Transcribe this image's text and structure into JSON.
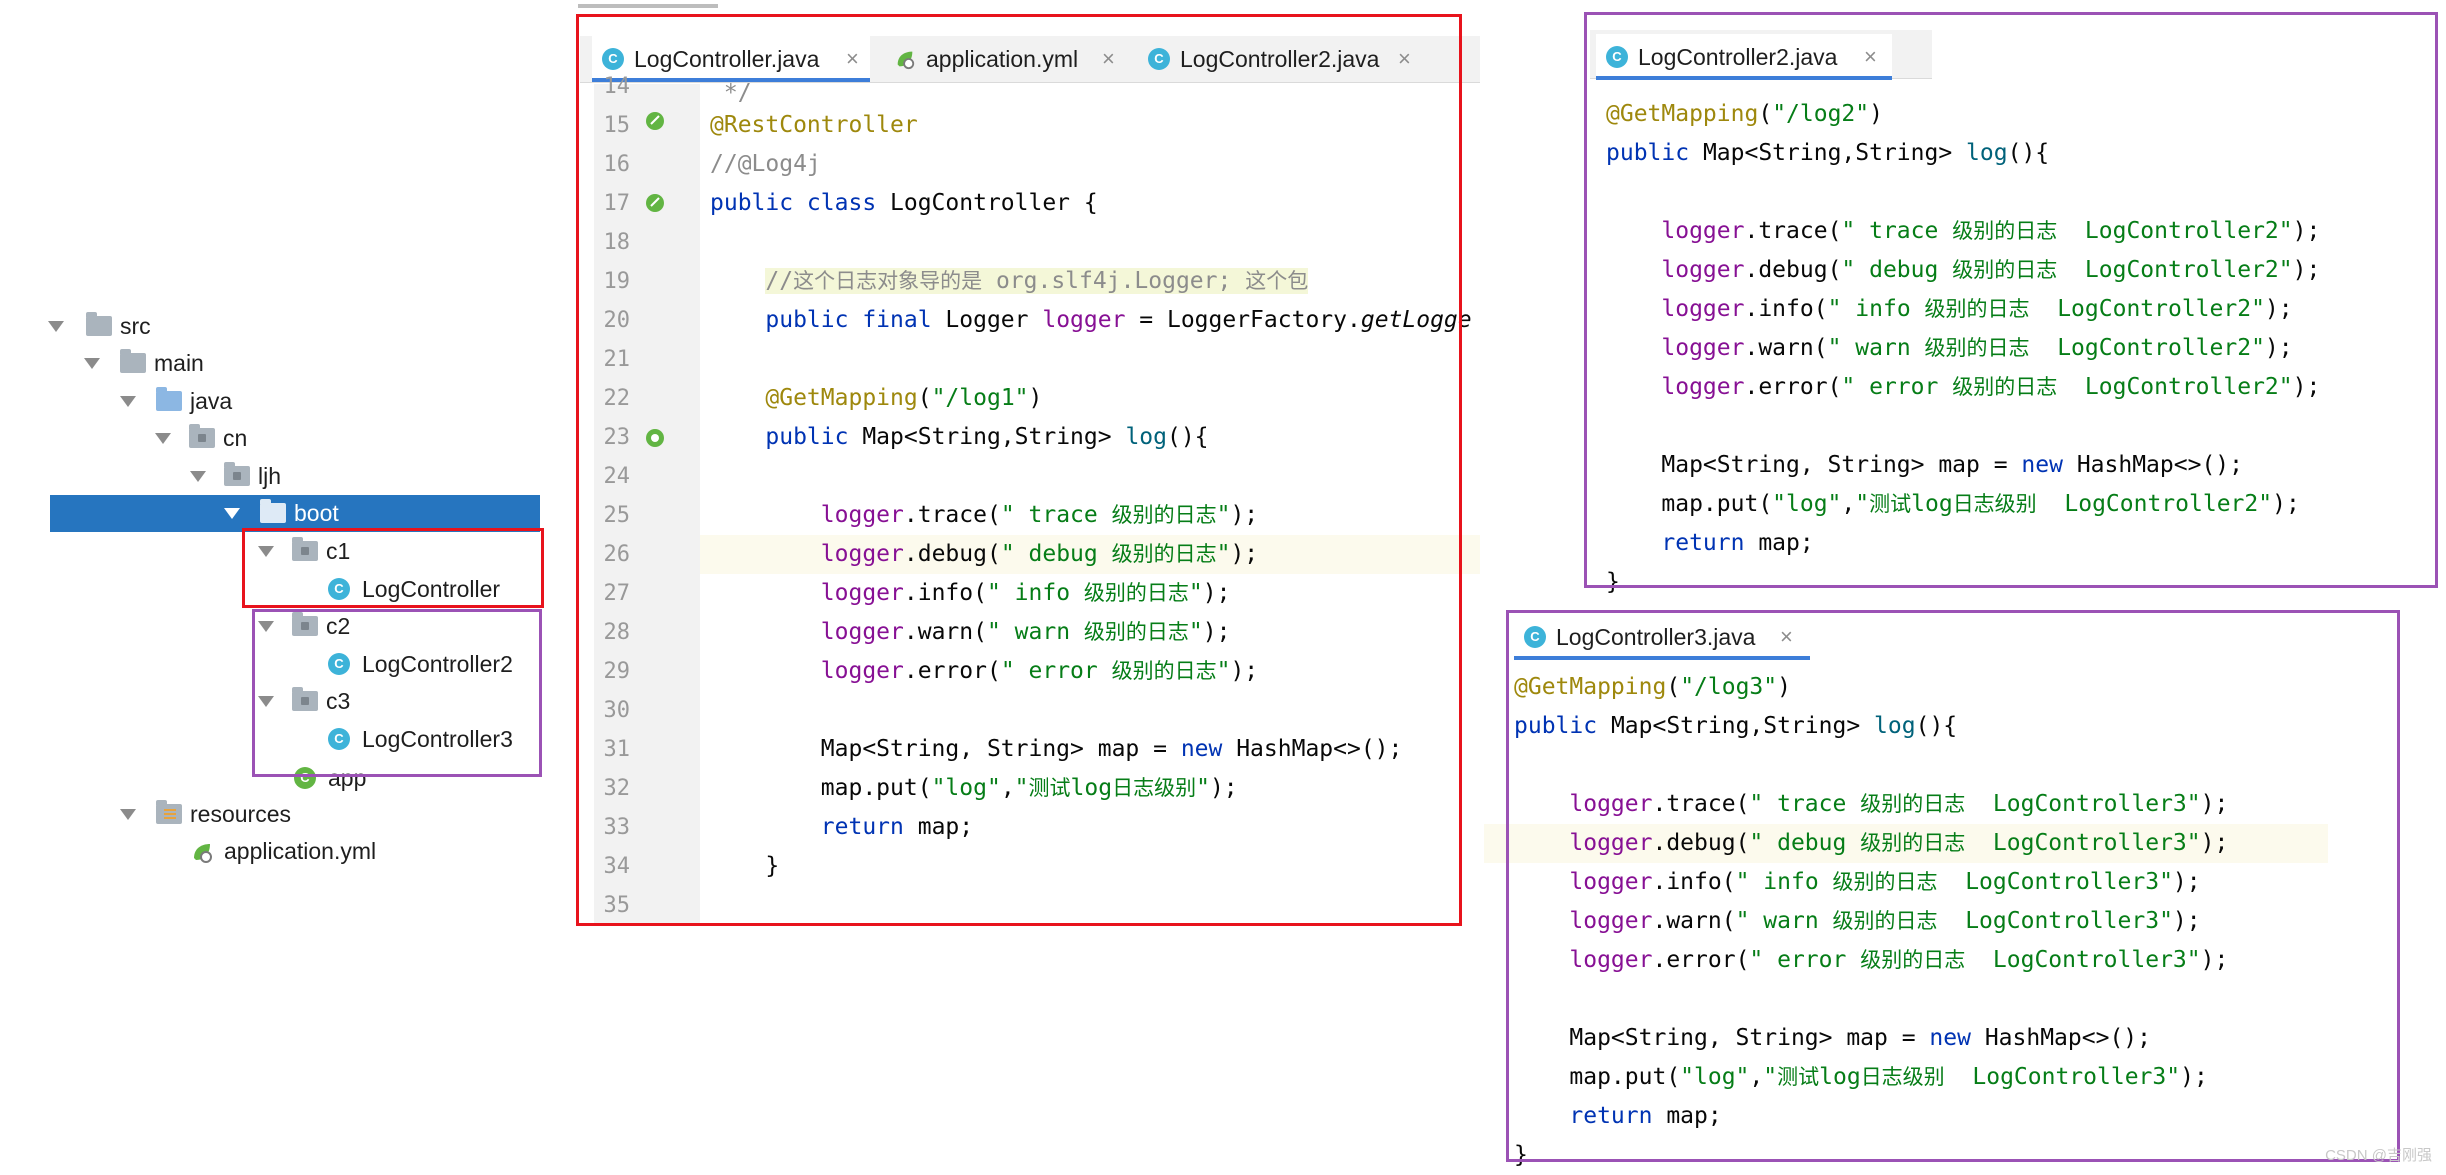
{
  "tree": {
    "items": [
      {
        "label": "src"
      },
      {
        "label": "main"
      },
      {
        "label": "java"
      },
      {
        "label": "cn"
      },
      {
        "label": "ljh"
      },
      {
        "label": "boot"
      },
      {
        "label": "c1"
      },
      {
        "label": "LogController"
      },
      {
        "label": "c2"
      },
      {
        "label": "LogController2"
      },
      {
        "label": "c3"
      },
      {
        "label": "LogController3"
      },
      {
        "label": "app"
      },
      {
        "label": "resources"
      },
      {
        "label": "application.yml"
      }
    ]
  },
  "editor1": {
    "tabs": [
      {
        "label": "LogController.java"
      },
      {
        "label": "application.yml"
      },
      {
        "label": "LogController2.java"
      }
    ],
    "line_numbers": [
      "14",
      "15",
      "16",
      "17",
      "18",
      "19",
      "20",
      "21",
      "22",
      "23",
      "24",
      "25",
      "26",
      "27",
      "28",
      "29",
      "30",
      "31",
      "32",
      "33",
      "34",
      "35"
    ]
  },
  "editor2": {
    "tabs": [
      {
        "label": "LogController2.java"
      }
    ]
  },
  "editor3": {
    "tabs": [
      {
        "label": "LogController3.java"
      }
    ]
  },
  "colors": {
    "keyword": "#0033b3",
    "annotation": "#9e880d",
    "string": "#067d17",
    "field": "#871094",
    "selection": "#2675bf",
    "red_box": "#e8131c",
    "purple_box": "#9b52b5"
  },
  "watermark": "CSDN @吉刚强"
}
